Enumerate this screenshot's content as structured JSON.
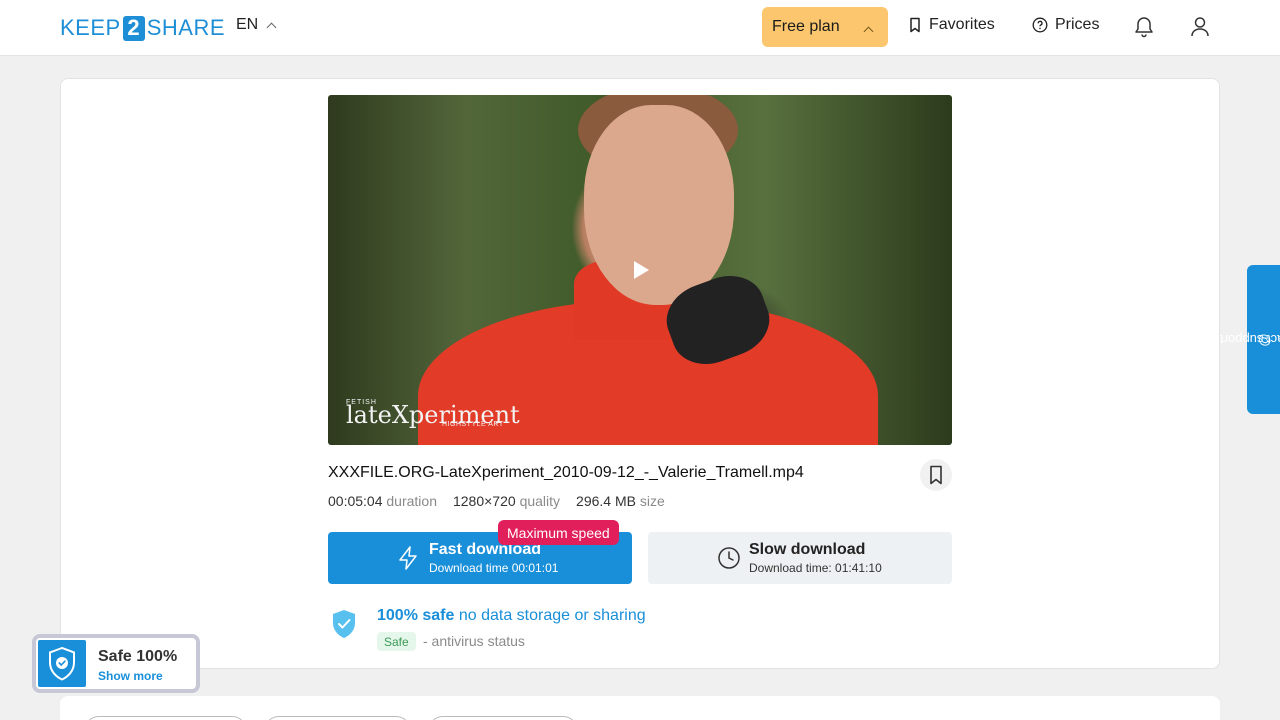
{
  "header": {
    "logo_left": "KEEP",
    "logo_num": "2",
    "logo_right": "SHARE",
    "language": "EN",
    "plan_label": "Free plan",
    "favorites_label": "Favorites",
    "prices_label": "Prices"
  },
  "video": {
    "watermark_small": "FETISH",
    "watermark_big": "lateXperiment",
    "watermark_tag": "HIGHSTYLE ART"
  },
  "file": {
    "name": "XXXFILE.ORG-LateXperiment_2010-09-12_-_Valerie_Tramell.mp4",
    "duration_value": "00:05:04",
    "duration_label": "duration",
    "quality_value": "1280×720",
    "quality_label": "quality",
    "size_value": "296.4 MB",
    "size_label": "size"
  },
  "download": {
    "fast_title": "Fast download",
    "fast_sub": "Download time 00:01:01",
    "max_speed_badge": "Maximum speed",
    "slow_title": "Slow download",
    "slow_sub": "Download time: 01:41:10"
  },
  "safety": {
    "bold": "100% safe",
    "rest": "no data storage or sharing",
    "badge": "Safe",
    "antivirus": "- antivirus status"
  },
  "contact_support": "contact support",
  "safe_widget": {
    "title": "Safe 100%",
    "link": "Show more"
  },
  "colors": {
    "accent": "#1a8fd9",
    "plan": "#fbc66d",
    "badge": "#e01f5b"
  }
}
